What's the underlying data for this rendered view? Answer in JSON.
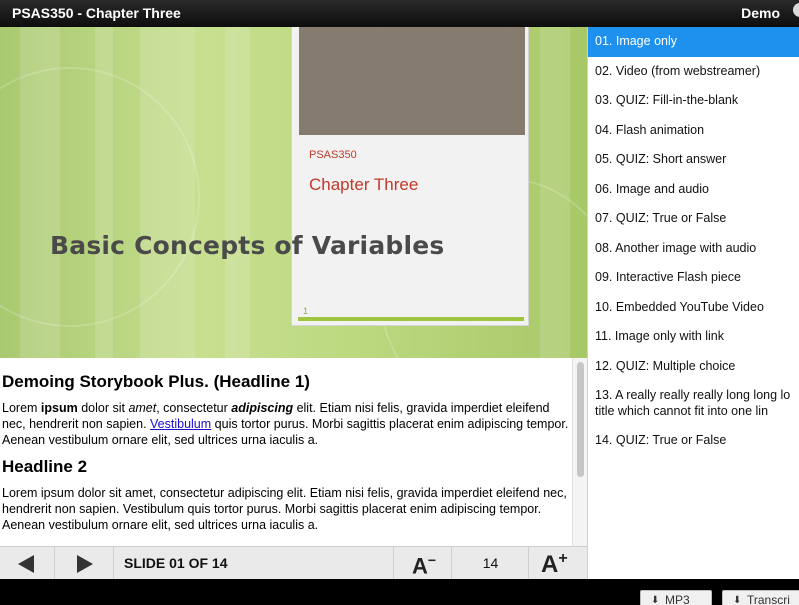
{
  "topbar": {
    "title": "PSAS350 - Chapter Three",
    "user": "Demo"
  },
  "slide": {
    "heading": "Basic Concepts of Variables",
    "card": {
      "course": "PSAS350",
      "chapter": "Chapter Three",
      "number": "1"
    }
  },
  "notes": {
    "h1": "Demoing Storybook Plus. (Headline 1)",
    "p1": {
      "t1": "Lorem ",
      "b1": "ipsum",
      "t2": " dolor sit ",
      "i1": "amet",
      "t3": ", consectetur ",
      "bi1": "adipiscing",
      "t4": " elit. Etiam nisi felis, gravida imperdiet eleifend nec, hendrerit non sapien. ",
      "link": "Vestibulum",
      "t5": " quis tortor purus. Morbi sagittis placerat enim adipiscing tempor. Aenean vestibulum ornare elit, sed ultrices urna iaculis a."
    },
    "h2": "Headline 2",
    "p2": "Lorem ipsum dolor sit amet, consectetur adipiscing elit. Etiam nisi felis, gravida imperdiet eleifend nec, hendrerit non sapien. Vestibulum quis tortor purus. Morbi sagittis placerat enim adipiscing tempor. Aenean vestibulum ornare elit, sed ultrices urna iaculis a."
  },
  "controls": {
    "slide_counter": "SLIDE 01 OF 14",
    "font_decrease": "A",
    "font_decrease_mark": "−",
    "font_size": "14",
    "font_increase": "A",
    "font_increase_mark": "+"
  },
  "sidebar": {
    "active_color": "#1e90ee",
    "items": [
      {
        "label": "01.  Image only"
      },
      {
        "label": "02.  Video (from webstreamer)"
      },
      {
        "label": "03.  QUIZ: Fill-in-the-blank"
      },
      {
        "label": "04.  Flash animation"
      },
      {
        "label": "05.  QUIZ: Short answer"
      },
      {
        "label": "06.  Image and audio"
      },
      {
        "label": "07.  QUIZ: True or False"
      },
      {
        "label": "08.  Another image with audio"
      },
      {
        "label": "09.  Interactive Flash piece"
      },
      {
        "label": "10.  Embedded YouTube Video"
      },
      {
        "label": "11.  Image only with link"
      },
      {
        "label": "12.  QUIZ: Multiple choice"
      },
      {
        "label": "13.  A really really really long long lo\n       title which cannot fit into one lin"
      },
      {
        "label": "14.  QUIZ: True or False"
      }
    ]
  },
  "footer": {
    "mp3": "MP3",
    "transcript": "Transcri"
  }
}
